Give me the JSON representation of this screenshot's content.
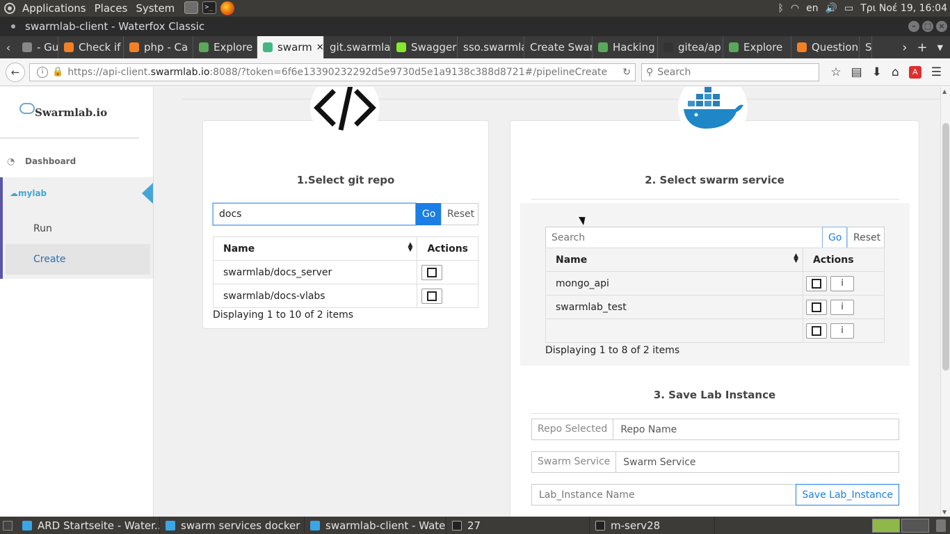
{
  "system": {
    "menus": [
      "Applications",
      "Places",
      "System"
    ],
    "lang": "en",
    "clock": "Τρι Νοέ 19, 16:04"
  },
  "window": {
    "title": "swarmlab-client - Waterfox Classic"
  },
  "tabs": [
    {
      "label": "- Gu",
      "fav": "#888888"
    },
    {
      "label": "Check if",
      "fav": "#f48024"
    },
    {
      "label": "php - Ca",
      "fav": "#f48024"
    },
    {
      "label": "Explore",
      "fav": "#5aa95a"
    },
    {
      "label": "swarm",
      "fav": "#41b883",
      "active": true
    },
    {
      "label": "git.swarmla",
      "fav": ""
    },
    {
      "label": "Swagger",
      "fav": "#85ea2d"
    },
    {
      "label": "sso.swarmla",
      "fav": ""
    },
    {
      "label": "Create Swar",
      "fav": ""
    },
    {
      "label": "Hacking",
      "fav": "#5aa95a"
    },
    {
      "label": "gitea/ap",
      "fav": "#333333"
    },
    {
      "label": "Explore",
      "fav": "#5aa95a"
    },
    {
      "label": "Question",
      "fav": "#f48024"
    },
    {
      "label": "S",
      "fav": ""
    }
  ],
  "nav": {
    "url_prefix": "https://api-client.",
    "url_host": "swarmlab.io",
    "url_rest": ":8088/?token=6f6e13390232292d5e9730d5e1a9138c388d8721#/pipelineCreate",
    "search_placeholder": "Search"
  },
  "sidebar": {
    "brand": "Swarmlab.io",
    "dashboard": "Dashboard",
    "mylab": "mylab",
    "run": "Run",
    "create": "Create"
  },
  "git": {
    "title": "1.Select git repo",
    "search_value": "docs",
    "go": "Go",
    "reset": "Reset",
    "col_name": "Name",
    "col_actions": "Actions",
    "rows": [
      "swarmlab/docs_server",
      "swarmlab/docs-vlabs"
    ],
    "footer": "Displaying 1 to 10 of 2 items"
  },
  "swarm": {
    "title": "2. Select swarm service",
    "search_placeholder": "Search",
    "go": "Go",
    "reset": "Reset",
    "col_name": "Name",
    "col_actions": "Actions",
    "rows": [
      "mongo_api",
      "swarmlab_test",
      ""
    ],
    "info_label": "i",
    "footer": "Displaying 1 to 8 of 2 items"
  },
  "save": {
    "title": "3. Save Lab Instance",
    "repo_addon": "Repo Selected",
    "repo_placeholder": "Repo Name",
    "service_addon": "Swarm Service",
    "service_placeholder": "Swarm Service",
    "instance_placeholder": "Lab_Instance Name",
    "save_button": "Save Lab_Instance"
  },
  "taskbar": [
    {
      "label": "ARD Startseite - Water...",
      "icon": "waterfox"
    },
    {
      "label": "swarm services docker ...",
      "icon": "waterfox"
    },
    {
      "label": "swarmlab-client - Wate...",
      "icon": "waterfox"
    },
    {
      "label": "27",
      "icon": "terminal"
    },
    {
      "label": "m-serv28",
      "icon": "terminal"
    }
  ],
  "colors": {
    "accent": "#1a7ee6",
    "sidebar_active": "#45a6d6",
    "sidebar_border": "#5b56a8"
  }
}
